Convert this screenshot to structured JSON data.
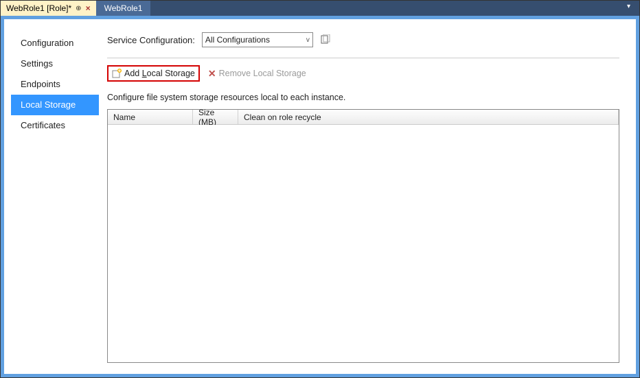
{
  "tabs": {
    "active": {
      "label": "WebRole1 [Role]*"
    },
    "inactive": {
      "label": "WebRole1"
    }
  },
  "sidebar": {
    "items": [
      {
        "label": "Configuration"
      },
      {
        "label": "Settings"
      },
      {
        "label": "Endpoints"
      },
      {
        "label": "Local Storage"
      },
      {
        "label": "Certificates"
      }
    ]
  },
  "service_config": {
    "label": "Service Configuration:",
    "value": "All Configurations"
  },
  "toolbar": {
    "add_prefix": "Add ",
    "add_hotkey": "L",
    "add_suffix": "ocal Storage",
    "remove_label": "Remove Local Storage"
  },
  "description": "Configure file system storage resources local to each instance.",
  "grid": {
    "columns": {
      "name": "Name",
      "size": "Size (MB)",
      "clean": "Clean on role recycle"
    }
  }
}
